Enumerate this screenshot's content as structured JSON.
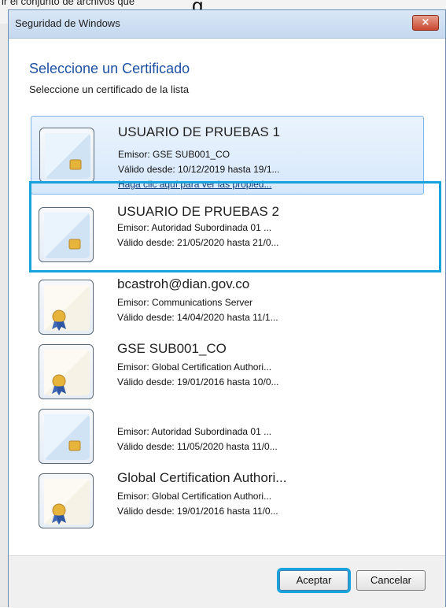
{
  "window": {
    "title": "Seguridad de Windows",
    "close_glyph": "×"
  },
  "background": {
    "partial_text": "ir el conjunto de archivos que",
    "partial_char": "g"
  },
  "heading": "Seleccione un Certificado",
  "subheading": "Seleccione un certificado de la lista",
  "certificates": [
    {
      "name": "USUARIO DE PRUEBAS 1",
      "issuer": "Emisor: GSE SUB001_CO",
      "validity": "Válido desde: 10/12/2019 hasta 19/1...",
      "link": "Haga clic aquí para ver las propied...",
      "icon": "smartcard-icon",
      "selected": true
    },
    {
      "name": "USUARIO DE PRUEBAS 2",
      "issuer": "Emisor: Autoridad Subordinada 01 ...",
      "validity": "Válido desde: 21/05/2020 hasta 21/0...",
      "icon": "smartcard-icon",
      "selected": false
    },
    {
      "name": "bcastroh@dian.gov.co",
      "issuer": "Emisor: Communications Server",
      "validity": "Válido desde: 14/04/2020 hasta 11/1...",
      "icon": "certificate-ribbon-icon",
      "selected": false
    },
    {
      "name": "GSE SUB001_CO",
      "issuer": "Emisor: Global Certification Authori...",
      "validity": "Válido desde: 19/01/2016 hasta 10/0...",
      "icon": "certificate-ribbon-icon",
      "selected": false
    },
    {
      "name": "",
      "issuer": "Emisor: Autoridad Subordinada 01 ...",
      "validity": "Válido desde: 11/05/2020 hasta 11/0...",
      "icon": "smartcard-icon",
      "selected": false
    },
    {
      "name": "Global Certification Authori...",
      "issuer": "Emisor: Global Certification Authori...",
      "validity": "Válido desde: 19/01/2016 hasta 11/0...",
      "icon": "certificate-ribbon-icon",
      "selected": false
    }
  ],
  "buttons": {
    "accept": "Aceptar",
    "cancel": "Cancelar"
  },
  "colors": {
    "accent_highlight": "#19a3dd",
    "heading_blue": "#1e50a2",
    "close_button_red": "#c9472f"
  }
}
